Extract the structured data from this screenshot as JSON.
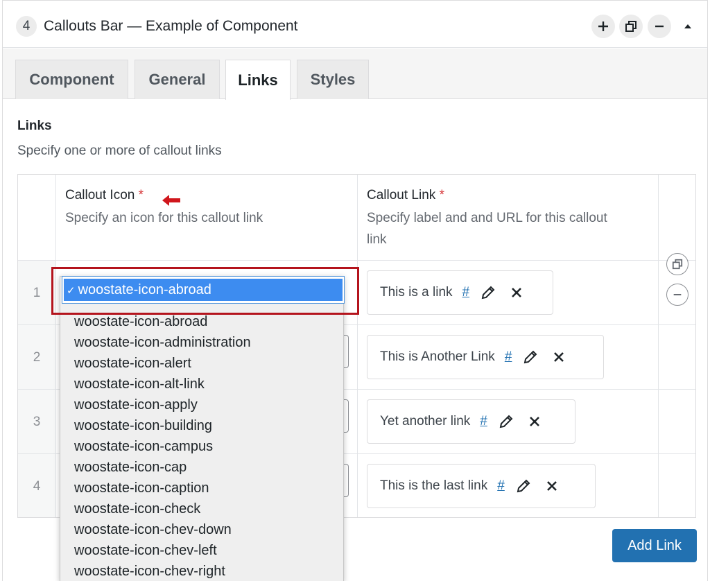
{
  "header": {
    "number": "4",
    "title": "Callouts Bar — Example of Component"
  },
  "tabs": [
    {
      "label": "Component"
    },
    {
      "label": "General"
    },
    {
      "label": "Links"
    },
    {
      "label": "Styles"
    }
  ],
  "section": {
    "title": "Links",
    "description": "Specify one or more of callout links"
  },
  "columns": {
    "icon": {
      "title": "Callout Icon",
      "required": "*",
      "description": "Specify an icon for this callout link"
    },
    "link": {
      "title": "Callout Link",
      "required": "*",
      "description_line1": "Specify label and and URL for this callout",
      "description_line2": "link"
    }
  },
  "rows": [
    {
      "number": "1",
      "link_label": "This is a link",
      "url": "#"
    },
    {
      "number": "2",
      "link_label": "This is Another Link",
      "url": "#"
    },
    {
      "number": "3",
      "link_label": "Yet another link",
      "url": "#"
    },
    {
      "number": "4",
      "link_label": "This is the last link",
      "url": "#"
    }
  ],
  "select": {
    "check": "✓",
    "selected": "woostate-icon-abroad",
    "options": [
      "woostate-icon-abroad",
      "woostate-icon-administration",
      "woostate-icon-alert",
      "woostate-icon-alt-link",
      "woostate-icon-apply",
      "woostate-icon-building",
      "woostate-icon-campus",
      "woostate-icon-cap",
      "woostate-icon-caption",
      "woostate-icon-check",
      "woostate-icon-chev-down",
      "woostate-icon-chev-left",
      "woostate-icon-chev-right"
    ]
  },
  "add_button": "Add Link",
  "colors": {
    "accent": "#2271b1",
    "highlight": "#b4141d",
    "selected_option": "#3d8cf0",
    "required": "#d63638"
  },
  "icons": {
    "add": "plus-icon",
    "duplicate": "duplicate-icon",
    "remove": "minus-icon",
    "collapse": "caret-up-icon",
    "edit": "pencil-icon",
    "delete": "close-icon",
    "pointer": "red-arrow-icon"
  }
}
